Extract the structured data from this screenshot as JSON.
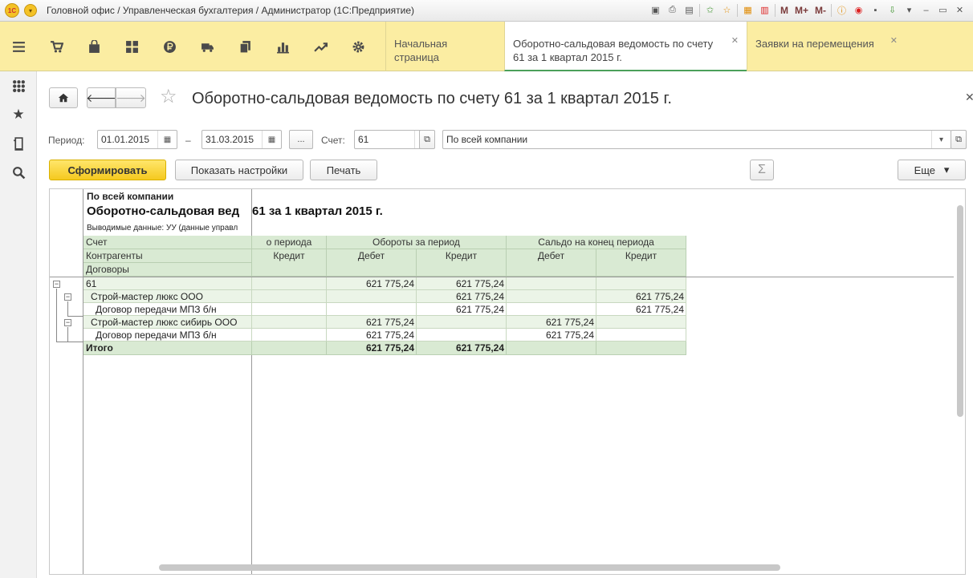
{
  "titlebar": {
    "logo": "1С",
    "title": "Головной офис / Управленческая бухгалтерия / Администратор  (1С:Предприятие)",
    "tools": {
      "m": "M",
      "m_plus": "M+",
      "m_minus": "M-"
    }
  },
  "sections": {
    "icons": [
      "menu-icon",
      "cart-icon",
      "shopping-bag-icon",
      "warehouse-icon",
      "ruble-icon",
      "truck-icon",
      "documents-icon",
      "bar-chart-icon",
      "trend-icon",
      "gear-icon"
    ]
  },
  "tabs": [
    {
      "label": "Начальная страница",
      "active": false,
      "closable": false
    },
    {
      "label": "Оборотно-сальдовая ведомость по счету 61 за 1 квартал 2015 г.",
      "active": true,
      "closable": true
    },
    {
      "label": "Заявки на перемещения",
      "active": false,
      "closable": true
    }
  ],
  "page": {
    "title": "Оборотно-сальдовая ведомость по счету 61 за 1 квартал 2015 г."
  },
  "filters": {
    "period_label": "Период:",
    "date_from": "01.01.2015",
    "dash": "–",
    "date_to": "31.03.2015",
    "dots": "...",
    "account_label": "Счет:",
    "account": "61",
    "company": "По всей компании"
  },
  "toolbar": {
    "generate": "Сформировать",
    "settings": "Показать настройки",
    "print": "Печать",
    "sum": "Σ",
    "more": "Еще"
  },
  "report": {
    "company": "По всей компании",
    "title_part1": "Оборотно-сальдовая вед",
    "title_part2": "61 за 1 квартал 2015 г.",
    "note": "Выводимые данные: УУ (данные управл",
    "header": {
      "account": "Счет",
      "counterparties": "Контрагенты",
      "contracts": "Договоры",
      "start_period": "о периода",
      "turnover": "Обороты за период",
      "end_balance": "Сальдо на конец периода",
      "credit": "Кредит",
      "debit": "Дебет"
    },
    "rows": [
      {
        "name": "61",
        "start_credit": "",
        "turn_debit": "621 775,24",
        "turn_credit": "621 775,24",
        "end_debit": "",
        "end_credit": ""
      },
      {
        "name": "Строй-мастер люкс ООО",
        "start_credit": "",
        "turn_debit": "",
        "turn_credit": "621 775,24",
        "end_debit": "",
        "end_credit": "621 775,24"
      },
      {
        "name": "Договор передачи МПЗ б/н",
        "start_credit": "",
        "turn_debit": "",
        "turn_credit": "621 775,24",
        "end_debit": "",
        "end_credit": "621 775,24"
      },
      {
        "name": "Строй-мастер люкс сибирь ООО",
        "start_credit": "",
        "turn_debit": "621 775,24",
        "turn_credit": "",
        "end_debit": "621 775,24",
        "end_credit": ""
      },
      {
        "name": "Договор передачи МПЗ б/н",
        "start_credit": "",
        "turn_debit": "621 775,24",
        "turn_credit": "",
        "end_debit": "621 775,24",
        "end_credit": ""
      }
    ],
    "total": {
      "name": "Итого",
      "start_credit": "",
      "turn_debit": "621 775,24",
      "turn_credit": "621 775,24",
      "end_debit": "",
      "end_credit": ""
    }
  }
}
